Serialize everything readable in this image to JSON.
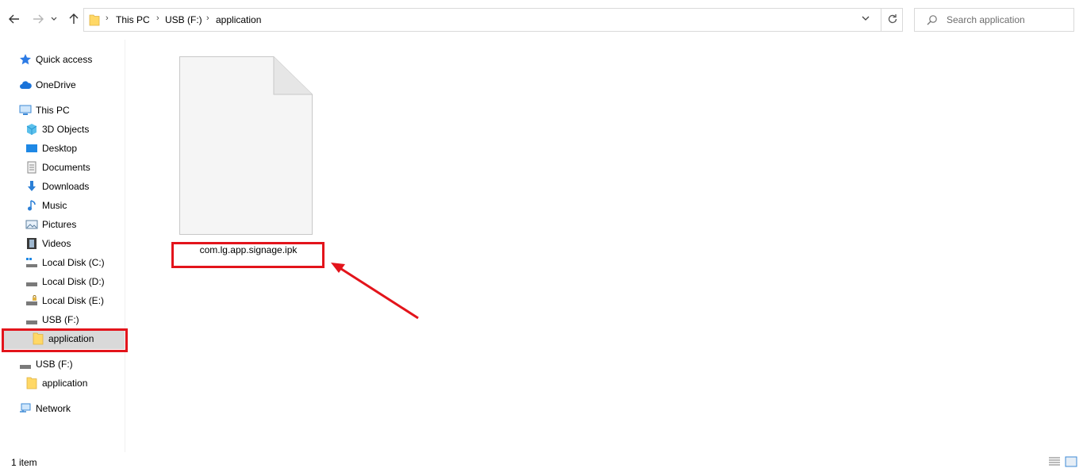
{
  "address": {
    "crumbs": [
      "This PC",
      "USB (F:)",
      "application"
    ]
  },
  "search": {
    "placeholder": "Search application"
  },
  "sidebar": {
    "items": [
      {
        "label": "Quick access",
        "icon": "star-icon"
      },
      {
        "label": "OneDrive",
        "icon": "cloud-icon"
      },
      {
        "label": "This PC",
        "icon": "computer-icon"
      },
      {
        "label": "3D Objects",
        "icon": "cube-icon"
      },
      {
        "label": "Desktop",
        "icon": "desktop-icon"
      },
      {
        "label": "Documents",
        "icon": "document-icon"
      },
      {
        "label": "Downloads",
        "icon": "download-icon"
      },
      {
        "label": "Music",
        "icon": "music-icon"
      },
      {
        "label": "Pictures",
        "icon": "picture-icon"
      },
      {
        "label": "Videos",
        "icon": "video-icon"
      },
      {
        "label": "Local Disk (C:)",
        "icon": "windows-drive-icon"
      },
      {
        "label": "Local Disk (D:)",
        "icon": "drive-icon"
      },
      {
        "label": "Local Disk (E:)",
        "icon": "locked-drive-icon"
      },
      {
        "label": "USB (F:)",
        "icon": "usb-drive-icon"
      },
      {
        "label": "application",
        "icon": "folder-icon"
      },
      {
        "label": "USB (F:)",
        "icon": "usb-drive-icon"
      },
      {
        "label": "application",
        "icon": "folder-icon"
      },
      {
        "label": "Network",
        "icon": "network-icon"
      }
    ]
  },
  "content": {
    "files": [
      {
        "name": "com.lg.app.signage.ipk",
        "icon": "blank-file-icon"
      }
    ]
  },
  "status": {
    "count": "1 item"
  },
  "colors": {
    "highlight": "#e3141b",
    "selection": "#d9d9d9",
    "folder": "#ffd866"
  }
}
